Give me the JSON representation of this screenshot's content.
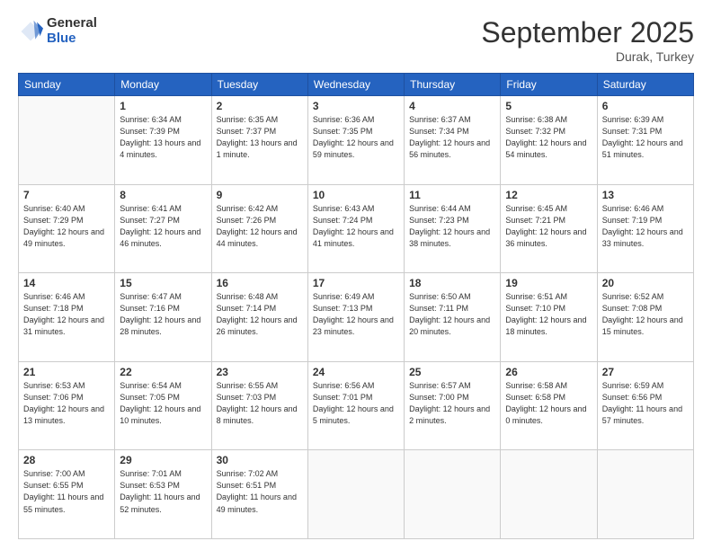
{
  "logo": {
    "general": "General",
    "blue": "Blue"
  },
  "header": {
    "month": "September 2025",
    "location": "Durak, Turkey"
  },
  "weekdays": [
    "Sunday",
    "Monday",
    "Tuesday",
    "Wednesday",
    "Thursday",
    "Friday",
    "Saturday"
  ],
  "weeks": [
    [
      {
        "day": "",
        "sunrise": "",
        "sunset": "",
        "daylight": ""
      },
      {
        "day": "1",
        "sunrise": "Sunrise: 6:34 AM",
        "sunset": "Sunset: 7:39 PM",
        "daylight": "Daylight: 13 hours and 4 minutes."
      },
      {
        "day": "2",
        "sunrise": "Sunrise: 6:35 AM",
        "sunset": "Sunset: 7:37 PM",
        "daylight": "Daylight: 13 hours and 1 minute."
      },
      {
        "day": "3",
        "sunrise": "Sunrise: 6:36 AM",
        "sunset": "Sunset: 7:35 PM",
        "daylight": "Daylight: 12 hours and 59 minutes."
      },
      {
        "day": "4",
        "sunrise": "Sunrise: 6:37 AM",
        "sunset": "Sunset: 7:34 PM",
        "daylight": "Daylight: 12 hours and 56 minutes."
      },
      {
        "day": "5",
        "sunrise": "Sunrise: 6:38 AM",
        "sunset": "Sunset: 7:32 PM",
        "daylight": "Daylight: 12 hours and 54 minutes."
      },
      {
        "day": "6",
        "sunrise": "Sunrise: 6:39 AM",
        "sunset": "Sunset: 7:31 PM",
        "daylight": "Daylight: 12 hours and 51 minutes."
      }
    ],
    [
      {
        "day": "7",
        "sunrise": "Sunrise: 6:40 AM",
        "sunset": "Sunset: 7:29 PM",
        "daylight": "Daylight: 12 hours and 49 minutes."
      },
      {
        "day": "8",
        "sunrise": "Sunrise: 6:41 AM",
        "sunset": "Sunset: 7:27 PM",
        "daylight": "Daylight: 12 hours and 46 minutes."
      },
      {
        "day": "9",
        "sunrise": "Sunrise: 6:42 AM",
        "sunset": "Sunset: 7:26 PM",
        "daylight": "Daylight: 12 hours and 44 minutes."
      },
      {
        "day": "10",
        "sunrise": "Sunrise: 6:43 AM",
        "sunset": "Sunset: 7:24 PM",
        "daylight": "Daylight: 12 hours and 41 minutes."
      },
      {
        "day": "11",
        "sunrise": "Sunrise: 6:44 AM",
        "sunset": "Sunset: 7:23 PM",
        "daylight": "Daylight: 12 hours and 38 minutes."
      },
      {
        "day": "12",
        "sunrise": "Sunrise: 6:45 AM",
        "sunset": "Sunset: 7:21 PM",
        "daylight": "Daylight: 12 hours and 36 minutes."
      },
      {
        "day": "13",
        "sunrise": "Sunrise: 6:46 AM",
        "sunset": "Sunset: 7:19 PM",
        "daylight": "Daylight: 12 hours and 33 minutes."
      }
    ],
    [
      {
        "day": "14",
        "sunrise": "Sunrise: 6:46 AM",
        "sunset": "Sunset: 7:18 PM",
        "daylight": "Daylight: 12 hours and 31 minutes."
      },
      {
        "day": "15",
        "sunrise": "Sunrise: 6:47 AM",
        "sunset": "Sunset: 7:16 PM",
        "daylight": "Daylight: 12 hours and 28 minutes."
      },
      {
        "day": "16",
        "sunrise": "Sunrise: 6:48 AM",
        "sunset": "Sunset: 7:14 PM",
        "daylight": "Daylight: 12 hours and 26 minutes."
      },
      {
        "day": "17",
        "sunrise": "Sunrise: 6:49 AM",
        "sunset": "Sunset: 7:13 PM",
        "daylight": "Daylight: 12 hours and 23 minutes."
      },
      {
        "day": "18",
        "sunrise": "Sunrise: 6:50 AM",
        "sunset": "Sunset: 7:11 PM",
        "daylight": "Daylight: 12 hours and 20 minutes."
      },
      {
        "day": "19",
        "sunrise": "Sunrise: 6:51 AM",
        "sunset": "Sunset: 7:10 PM",
        "daylight": "Daylight: 12 hours and 18 minutes."
      },
      {
        "day": "20",
        "sunrise": "Sunrise: 6:52 AM",
        "sunset": "Sunset: 7:08 PM",
        "daylight": "Daylight: 12 hours and 15 minutes."
      }
    ],
    [
      {
        "day": "21",
        "sunrise": "Sunrise: 6:53 AM",
        "sunset": "Sunset: 7:06 PM",
        "daylight": "Daylight: 12 hours and 13 minutes."
      },
      {
        "day": "22",
        "sunrise": "Sunrise: 6:54 AM",
        "sunset": "Sunset: 7:05 PM",
        "daylight": "Daylight: 12 hours and 10 minutes."
      },
      {
        "day": "23",
        "sunrise": "Sunrise: 6:55 AM",
        "sunset": "Sunset: 7:03 PM",
        "daylight": "Daylight: 12 hours and 8 minutes."
      },
      {
        "day": "24",
        "sunrise": "Sunrise: 6:56 AM",
        "sunset": "Sunset: 7:01 PM",
        "daylight": "Daylight: 12 hours and 5 minutes."
      },
      {
        "day": "25",
        "sunrise": "Sunrise: 6:57 AM",
        "sunset": "Sunset: 7:00 PM",
        "daylight": "Daylight: 12 hours and 2 minutes."
      },
      {
        "day": "26",
        "sunrise": "Sunrise: 6:58 AM",
        "sunset": "Sunset: 6:58 PM",
        "daylight": "Daylight: 12 hours and 0 minutes."
      },
      {
        "day": "27",
        "sunrise": "Sunrise: 6:59 AM",
        "sunset": "Sunset: 6:56 PM",
        "daylight": "Daylight: 11 hours and 57 minutes."
      }
    ],
    [
      {
        "day": "28",
        "sunrise": "Sunrise: 7:00 AM",
        "sunset": "Sunset: 6:55 PM",
        "daylight": "Daylight: 11 hours and 55 minutes."
      },
      {
        "day": "29",
        "sunrise": "Sunrise: 7:01 AM",
        "sunset": "Sunset: 6:53 PM",
        "daylight": "Daylight: 11 hours and 52 minutes."
      },
      {
        "day": "30",
        "sunrise": "Sunrise: 7:02 AM",
        "sunset": "Sunset: 6:51 PM",
        "daylight": "Daylight: 11 hours and 49 minutes."
      },
      {
        "day": "",
        "sunrise": "",
        "sunset": "",
        "daylight": ""
      },
      {
        "day": "",
        "sunrise": "",
        "sunset": "",
        "daylight": ""
      },
      {
        "day": "",
        "sunrise": "",
        "sunset": "",
        "daylight": ""
      },
      {
        "day": "",
        "sunrise": "",
        "sunset": "",
        "daylight": ""
      }
    ]
  ]
}
